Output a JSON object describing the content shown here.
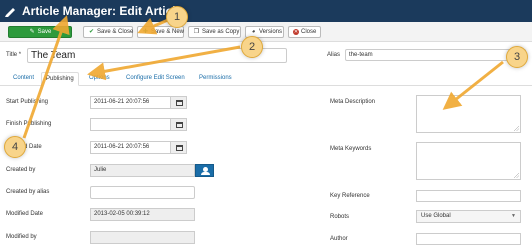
{
  "header": {
    "title": "Article Manager: Edit Article"
  },
  "toolbar": {
    "save": "Save",
    "save_close": "Save & Close",
    "save_new": "Save & New",
    "save_copy": "Save as Copy",
    "versions": "Versions",
    "close": "Close"
  },
  "form": {
    "title_label": "Title *",
    "title_value": "The Team",
    "alias_label": "Alias",
    "alias_value": "the-team"
  },
  "tabs": [
    "Content",
    "Publishing",
    "Options",
    "Configure Edit Screen",
    "Permissions"
  ],
  "left_fields": {
    "start_publishing_label": "Start Publishing",
    "start_publishing_value": "2011-06-21 20:07:56",
    "finish_publishing_label": "Finish Publishing",
    "created_date_label": "Created Date",
    "created_date_value": "2011-06-21 20:07:56",
    "created_by_label": "Created by",
    "created_by_value": "Julie",
    "created_by_alias_label": "Created by alias",
    "modified_date_label": "Modified Date",
    "modified_date_value": "2013-02-05 00:39:12",
    "modified_by_label": "Modified by"
  },
  "right_fields": {
    "meta_description_label": "Meta Description",
    "meta_keywords_label": "Meta Keywords",
    "key_reference_label": "Key Reference",
    "robots_label": "Robots",
    "robots_value": "Use Global",
    "author_label": "Author"
  },
  "callouts": [
    "1",
    "2",
    "3",
    "4"
  ],
  "colors": {
    "header_bg": "#1b3a5c",
    "save_green": "#2d9a3c",
    "link_blue": "#1a6da8",
    "callout_fill": "#f8d48a",
    "arrow_orange": "#f0a830"
  }
}
